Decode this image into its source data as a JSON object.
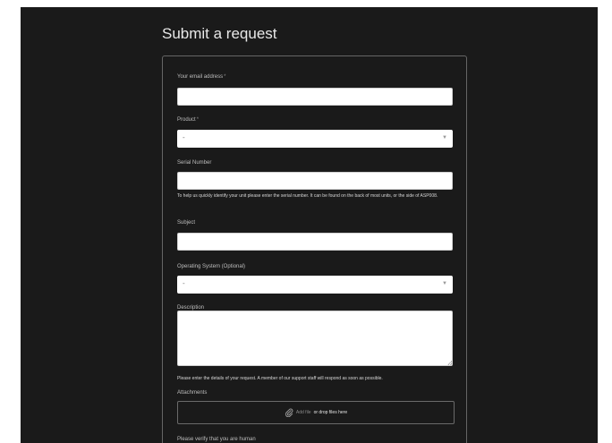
{
  "page": {
    "title": "Submit a request"
  },
  "form": {
    "email": {
      "label": "Your email address",
      "required_mark": "*",
      "value": ""
    },
    "product": {
      "label": "Product",
      "required_mark": "*",
      "selected": "-"
    },
    "serial": {
      "label": "Serial Number",
      "value": "",
      "hint": "To help us quickly identify your unit please enter the serial number. It can be found on the back of most units, or the side of ASP008."
    },
    "subject": {
      "label": "Subject",
      "value": ""
    },
    "os": {
      "label": "Operating System (Optional)",
      "selected": "-"
    },
    "description": {
      "label": "Description",
      "value": "",
      "hint": "Please enter the details of your request. A member of our support staff will respond as soon as possible."
    },
    "attachments": {
      "label": "Attachments",
      "add_file_label": "Add file",
      "drop_label": "or drop files here",
      "icon": "paperclip-icon"
    },
    "captcha": {
      "label": "Please verify that you are human"
    }
  },
  "colors": {
    "background": "#1a1a1a",
    "panel_border": "#666666",
    "input_background": "#ffffff",
    "label_text": "#bdbdbd"
  }
}
